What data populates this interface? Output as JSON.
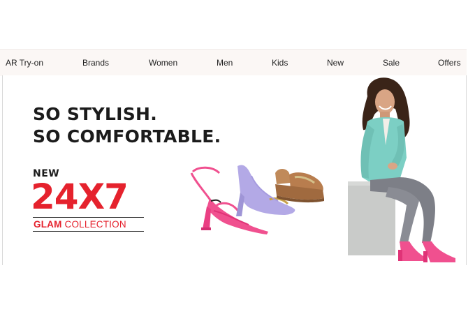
{
  "nav": {
    "items": [
      {
        "label": "AR Try-on"
      },
      {
        "label": "Brands"
      },
      {
        "label": "Women"
      },
      {
        "label": "Men"
      },
      {
        "label": "Kids"
      },
      {
        "label": "New"
      },
      {
        "label": "Sale"
      },
      {
        "label": "Offers"
      }
    ]
  },
  "banner": {
    "headline_line1": "SO STYLISH.",
    "headline_line2": "SO COMFORTABLE.",
    "new_tag": "NEW",
    "collection_number": "24X7",
    "collection_glam": "GLAM",
    "collection_word": "COLLECTION",
    "colors": {
      "accent_red": "#e5222d",
      "headline_dark": "#1b1b1b",
      "nav_bg": "#fbf7f5",
      "pink_heel": "#f0508f",
      "lavender_heel": "#b3a9e6",
      "tan_sandal": "#c08a5a",
      "jacket_mint": "#7ccfc4",
      "jeans_grey": "#7d7f87",
      "stool_grey": "#c9cbc9"
    },
    "images": {
      "shoes": "shoe-trio-image",
      "model": "model-seated-image"
    }
  }
}
